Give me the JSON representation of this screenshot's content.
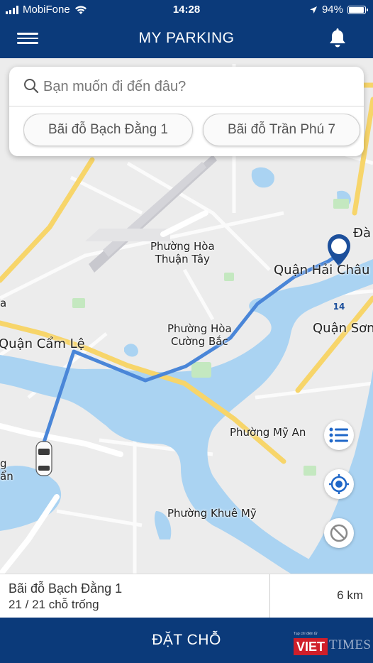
{
  "status_bar": {
    "carrier": "MobiFone",
    "time": "14:28",
    "battery": "94%",
    "battery_level": 0.94
  },
  "header": {
    "title": "MY PARKING",
    "menu_icon": "hamburger-menu-icon",
    "notification_icon": "bell-icon"
  },
  "search": {
    "placeholder": "Bạn muốn đi đến đâu?",
    "value": "",
    "suggestions": [
      "Bãi đỗ Bạch Đằng 1",
      "Bãi đỗ Trần Phú 7"
    ]
  },
  "map": {
    "labels": {
      "hoa_thuan_tay": "Phường Hòa\nThuận Tây",
      "hai_chau": "Quận Hải Châu",
      "da_nang": "Đà",
      "cam_le": "Quận Cẩm Lệ",
      "hoa_cuong_bac": "Phường Hòa\nCường Bắc",
      "son_tra": "Quận Sơn",
      "my_an": "Phường Mỹ An",
      "khue_my": "Phường Khuê Mỹ",
      "left_edge_a": "a",
      "left_edge_g": "g\nẩn"
    },
    "destination_marker_number": "14",
    "route_color": "#4a86d8",
    "water_color": "#aad3f2",
    "pin_color": "#1c4f9b"
  },
  "map_controls": {
    "list_icon": "list-icon",
    "locate_icon": "crosshair-icon",
    "cancel_icon": "no-entry-icon"
  },
  "selected_parking": {
    "name": "Bãi đỗ Bạch Đằng 1",
    "slots": "21 / 21 chỗ trống",
    "distance": "6 km"
  },
  "book_button": {
    "label": "ĐẶT CHỖ"
  },
  "watermark": {
    "tagline": "Tạp chí điện tử",
    "brand_viet": "VIET",
    "brand_times": "TIMES"
  },
  "colors": {
    "header_bg": "#0b3a7a",
    "accent_blue": "#1f67c8"
  }
}
